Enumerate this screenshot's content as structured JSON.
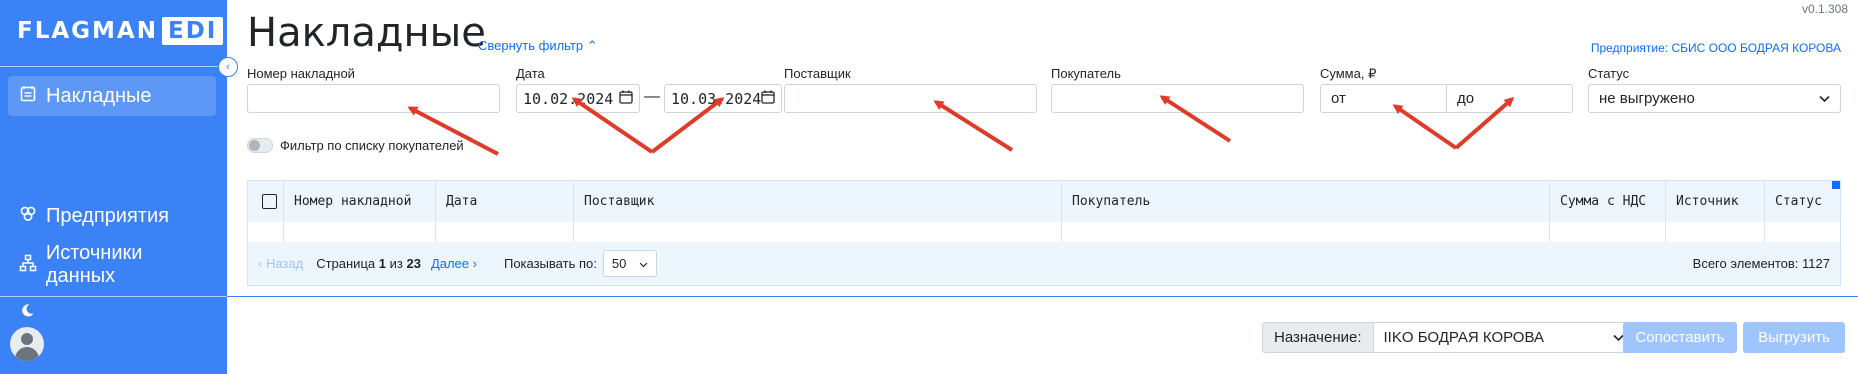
{
  "app": {
    "logo_main": "FLAGMAN",
    "logo_badge": "EDI",
    "version": "v0.1.308"
  },
  "sidebar": {
    "collapse_icon": "‹",
    "items": [
      {
        "label": "Накладные",
        "icon": "invoice-icon",
        "active": true
      },
      {
        "label": "Предприятия",
        "icon": "enterprises-icon",
        "active": false
      },
      {
        "label": "Источники данных",
        "icon": "data-sources-icon",
        "active": false
      }
    ]
  },
  "header": {
    "title": "Накладные",
    "collapse_filter": "Свернуть фильтр ⌃",
    "enterprise": "Предприятие: СБИС ООО БОДРАЯ КОРОВА"
  },
  "filters": {
    "invoice_number": {
      "label": "Номер накладной",
      "value": ""
    },
    "date": {
      "label": "Дата",
      "from": "10.02.2024",
      "to": "10.03.2024",
      "separator": "—"
    },
    "supplier": {
      "label": "Поставщик",
      "value": ""
    },
    "buyer": {
      "label": "Покупатель",
      "value": ""
    },
    "amount": {
      "label": "Сумма, ₽",
      "from_placeholder": "от",
      "to_placeholder": "до"
    },
    "status": {
      "label": "Статус",
      "value": "не выгружено"
    },
    "toggle_label": "Фильтр по списку покупателей"
  },
  "table": {
    "columns": [
      "Номер накладной",
      "Дата",
      "Поставщик",
      "Покупатель",
      "Сумма с НДС",
      "Источник",
      "Статус"
    ]
  },
  "pagination": {
    "prev": "‹ Назад",
    "page_text": "Страница",
    "page": "1",
    "of_text": "из",
    "total_pages": "23",
    "next": "Далее ›",
    "show_label": "Показывать по:",
    "per_page": "50",
    "total": "Всего элементов: 1127"
  },
  "footer": {
    "destination_label": "Назначение:",
    "destination_value": "IIKO БОДРАЯ КОРОВА",
    "match_button": "Сопоставить",
    "export_button": "Выгрузить"
  },
  "colors": {
    "primary": "#3b82f6",
    "link": "#0d6efd",
    "disabled_button": "#9ec5fe",
    "annotation_arrow": "#e03a2a"
  }
}
